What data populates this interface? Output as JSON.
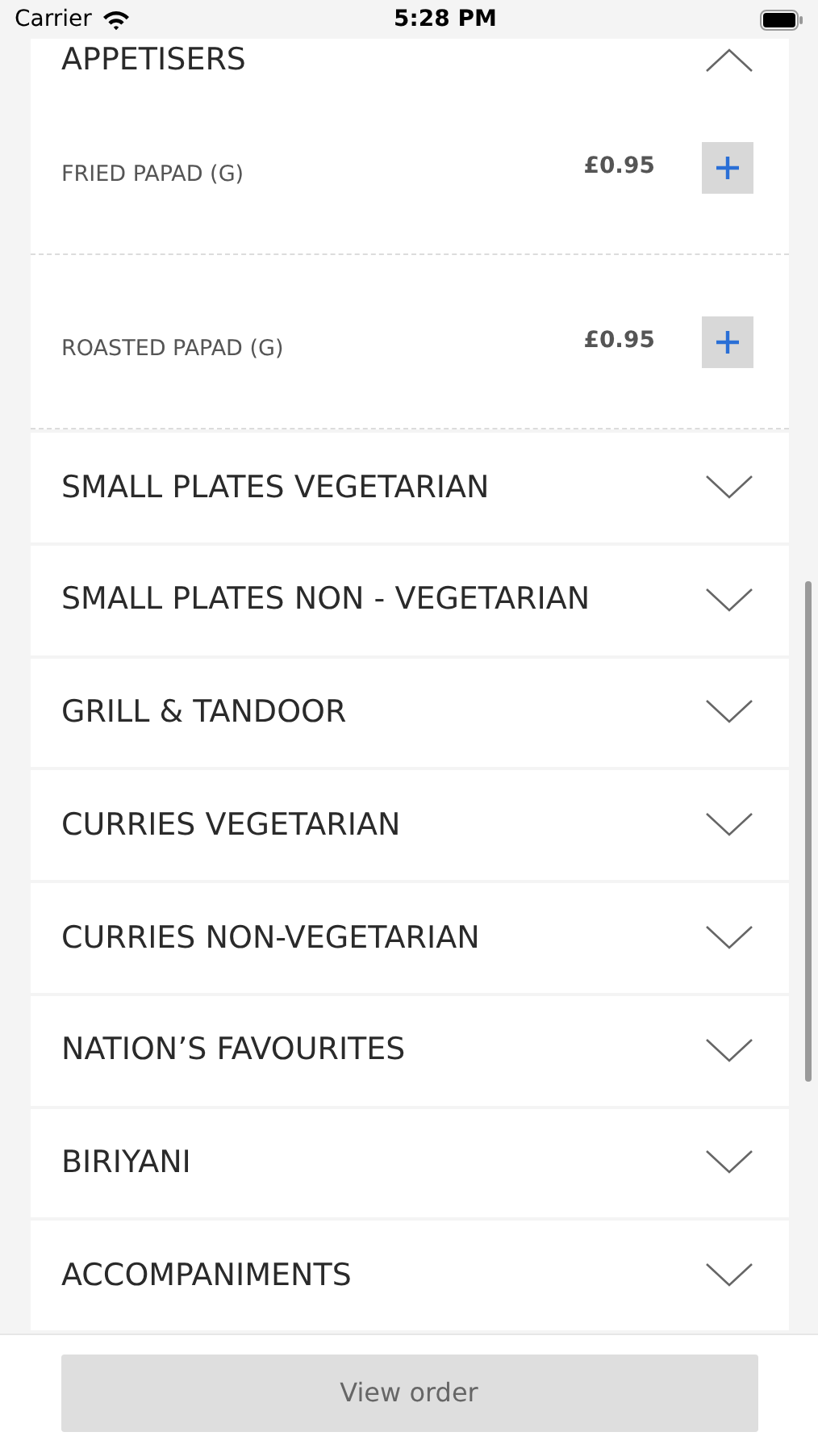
{
  "status_bar": {
    "carrier": "Carrier",
    "time": "5:28 PM"
  },
  "categories": [
    {
      "title": "APPETISERS",
      "expanded": true,
      "items": [
        {
          "name": "FRIED PAPAD (G)",
          "price": "£0.95"
        },
        {
          "name": "ROASTED PAPAD (G)",
          "price": "£0.95"
        }
      ]
    },
    {
      "title": "SMALL PLATES VEGETARIAN",
      "expanded": false
    },
    {
      "title": "SMALL PLATES NON - VEGETARIAN",
      "expanded": false
    },
    {
      "title": "GRILL & TANDOOR",
      "expanded": false
    },
    {
      "title": "CURRIES VEGETARIAN",
      "expanded": false
    },
    {
      "title": "CURRIES NON-VEGETARIAN",
      "expanded": false
    },
    {
      "title": "NATION’S FAVOURITES",
      "expanded": false
    },
    {
      "title": "BIRIYANI",
      "expanded": false
    },
    {
      "title": "ACCOMPANIMENTS",
      "expanded": false
    }
  ],
  "footer_button": {
    "label": "View order",
    "disabled": true
  }
}
